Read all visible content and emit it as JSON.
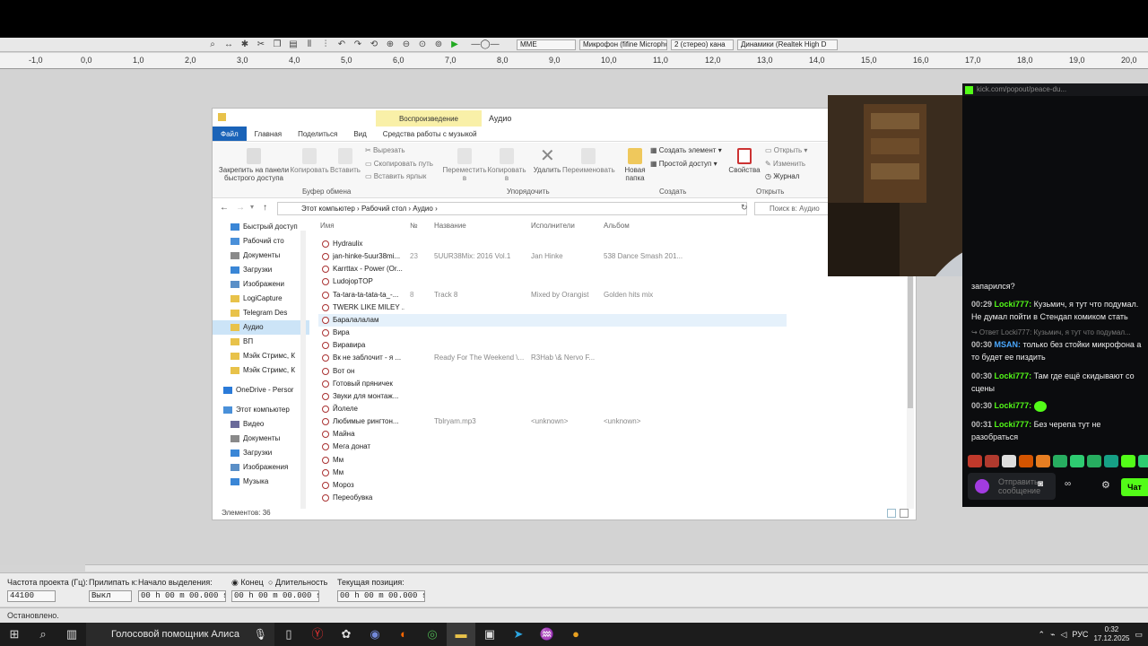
{
  "audacity": {
    "toolbar": {
      "host": "MME",
      "mic": "Микрофон (fifine Micropho",
      "channels": "2 (стерео) кана",
      "speakers": "Динамики (Realtek High D"
    },
    "ruler_ticks": [
      "-1,0",
      "0,0",
      "1,0",
      "2,0",
      "3,0",
      "4,0",
      "5,0",
      "6,0",
      "7,0",
      "8,0",
      "9,0",
      "10,0",
      "11,0",
      "12,0",
      "13,0",
      "14,0",
      "15,0",
      "16,0",
      "17,0",
      "18,0",
      "19,0",
      "20,0"
    ],
    "selection_bar": {
      "project_rate_label": "Частота проекта (Гц):",
      "project_rate": "44100",
      "snap_label": "Прилипать к:",
      "snap_value": "Выкл",
      "sel_start_label": "Начало выделения:",
      "end_label": "Конец",
      "length_label": "Длительность",
      "sel_start": "00 h 00 m 00.000 s",
      "sel_end": "00 h 00 m 00.000 s",
      "position_label": "Текущая позиция:",
      "position": "00 h 00 m 00.000 s"
    },
    "status": "Остановлено."
  },
  "explorer": {
    "context_tab": "Воспроизведение",
    "title": "Аудио",
    "tabs": [
      "Файл",
      "Главная",
      "Поделиться",
      "Вид",
      "Средства работы с музыкой"
    ],
    "ribbon": {
      "pin": "Закрепить на панели быстрого доступа",
      "copy": "Копировать",
      "paste": "Вставить",
      "cut": "Вырезать",
      "copy_path": "Скопировать путь",
      "paste_shortcut": "Вставить ярлык",
      "clipboard_group": "Буфер обмена",
      "move_to": "Переместить в",
      "copy_to": "Копировать в",
      "delete": "Удалить",
      "rename": "Переименовать",
      "organize_group": "Упорядочить",
      "new_folder": "Новая папка",
      "new_item": "Создать элемент",
      "easy_access": "Простой доступ",
      "create_group": "Создать",
      "properties": "Свойства",
      "open": "Открыть",
      "edit": "Изменить",
      "history": "Журнал",
      "open_group": "Открыть"
    },
    "breadcrumb": [
      "Этот компьютер",
      "Рабочий стол",
      "Аудио"
    ],
    "search_placeholder": "Поиск в: Аудио",
    "nav": [
      {
        "label": "Быстрый доступ",
        "kind": "star"
      },
      {
        "label": "Рабочий сто",
        "kind": "desk"
      },
      {
        "label": "Документы",
        "kind": "doc"
      },
      {
        "label": "Загрузки",
        "kind": "down"
      },
      {
        "label": "Изображени",
        "kind": "img"
      },
      {
        "label": "LogiCapture",
        "kind": "folder"
      },
      {
        "label": "Telegram Des",
        "kind": "folder"
      },
      {
        "label": "Аудио",
        "kind": "folder"
      },
      {
        "label": "ВП",
        "kind": "folder"
      },
      {
        "label": "Мэйк Стримс, К",
        "kind": "folder"
      },
      {
        "label": "Мэйк Стримс, К",
        "kind": "folder"
      },
      {
        "label": "OneDrive - Persor",
        "kind": "cloud"
      },
      {
        "label": "Этот компьютер",
        "kind": "pc"
      },
      {
        "label": "Видео",
        "kind": "video"
      },
      {
        "label": "Документы",
        "kind": "doc"
      },
      {
        "label": "Загрузки",
        "kind": "down"
      },
      {
        "label": "Изображения",
        "kind": "img"
      },
      {
        "label": "Музыка",
        "kind": "music"
      }
    ],
    "columns": {
      "name": "Имя",
      "no": "№",
      "title": "Название",
      "artist": "Исполнители",
      "album": "Альбом"
    },
    "files": [
      {
        "name": "Hydraulix",
        "no": "",
        "title": "",
        "artist": "",
        "album": ""
      },
      {
        "name": "jan-hinke-5uur38mi...",
        "no": "23",
        "title": "5UUR38Mix: 2016 Vol.1",
        "artist": "Jan Hinke",
        "album": "538 Dance Smash 201..."
      },
      {
        "name": "Karrttax - Power (Or...",
        "no": "",
        "title": "",
        "artist": "",
        "album": ""
      },
      {
        "name": "LudojopTOP",
        "no": "",
        "title": "",
        "artist": "",
        "album": ""
      },
      {
        "name": "Ta-tara-ta-tata-ta_-...",
        "no": "8",
        "title": "Track 8",
        "artist": "Mixed by Orangist",
        "album": "Golden hits mix"
      },
      {
        "name": "TWERK LIKE MILEY ...",
        "no": "",
        "title": "",
        "artist": "",
        "album": ""
      },
      {
        "name": "Баралалалам",
        "no": "",
        "title": "",
        "artist": "",
        "album": ""
      },
      {
        "name": "Вира",
        "no": "",
        "title": "",
        "artist": "",
        "album": ""
      },
      {
        "name": "Виравира",
        "no": "",
        "title": "",
        "artist": "",
        "album": ""
      },
      {
        "name": "Вк не заблочит - я ...",
        "no": "",
        "title": "Ready For The Weekend \\...",
        "artist": "R3Hab \\& Nervo F...",
        "album": ""
      },
      {
        "name": "Вот он",
        "no": "",
        "title": "",
        "artist": "",
        "album": ""
      },
      {
        "name": "Готовый пряничек",
        "no": "",
        "title": "",
        "artist": "",
        "album": ""
      },
      {
        "name": "Звуки для монтаж...",
        "no": "",
        "title": "",
        "artist": "",
        "album": ""
      },
      {
        "name": "Йолеле",
        "no": "",
        "title": "",
        "artist": "",
        "album": ""
      },
      {
        "name": "Любимые рингтон...",
        "no": "",
        "title": "Tblryam.mp3",
        "artist": "<unknown>",
        "album": "<unknown>"
      },
      {
        "name": "Майна",
        "no": "",
        "title": "",
        "artist": "",
        "album": ""
      },
      {
        "name": "Мега донат",
        "no": "",
        "title": "",
        "artist": "",
        "album": ""
      },
      {
        "name": "Мм",
        "no": "",
        "title": "",
        "artist": "",
        "album": ""
      },
      {
        "name": "Мм",
        "no": "",
        "title": "",
        "artist": "",
        "album": ""
      },
      {
        "name": "Мороз",
        "no": "",
        "title": "",
        "artist": "",
        "album": ""
      },
      {
        "name": "Переобувка",
        "no": "",
        "title": "",
        "artist": "",
        "album": ""
      }
    ],
    "status": "Элементов: 36"
  },
  "chat": {
    "url": "kick.com/popout/peace-du...",
    "messages": [
      {
        "time": "",
        "user": "",
        "text": "запарился?"
      },
      {
        "time": "00:29",
        "user": "Locki777:",
        "text": "Кузьмич, я тут что подумал. Не думал пойти в Стендап комиком стать"
      },
      {
        "time": "",
        "user": "",
        "text": "↪ Ответ Locki777: Кузьмич, я тут что подумал..."
      },
      {
        "time": "00:30",
        "user": "MSAN:",
        "text": "только без стойки микрофона а то будет ее пиздить"
      },
      {
        "time": "00:30",
        "user": "Locki777:",
        "text": "Там где ещё скидывают со сцены"
      },
      {
        "time": "00:30",
        "user": "Locki777:",
        "text": ""
      },
      {
        "time": "00:31",
        "user": "Locki777:",
        "text": "Без черепа тут не разобраться"
      }
    ],
    "input_placeholder": "Отправить сообщение",
    "send_label": "Чат"
  },
  "taskbar": {
    "assistant": "Голосовой помощник Алиса",
    "lang": "РУС",
    "time": "0:32",
    "date": "17.12.2025"
  },
  "colors": {
    "kick_green": "#53fc18",
    "file_tab": "#1a63b8",
    "context_tab": "#f9f0a8"
  }
}
